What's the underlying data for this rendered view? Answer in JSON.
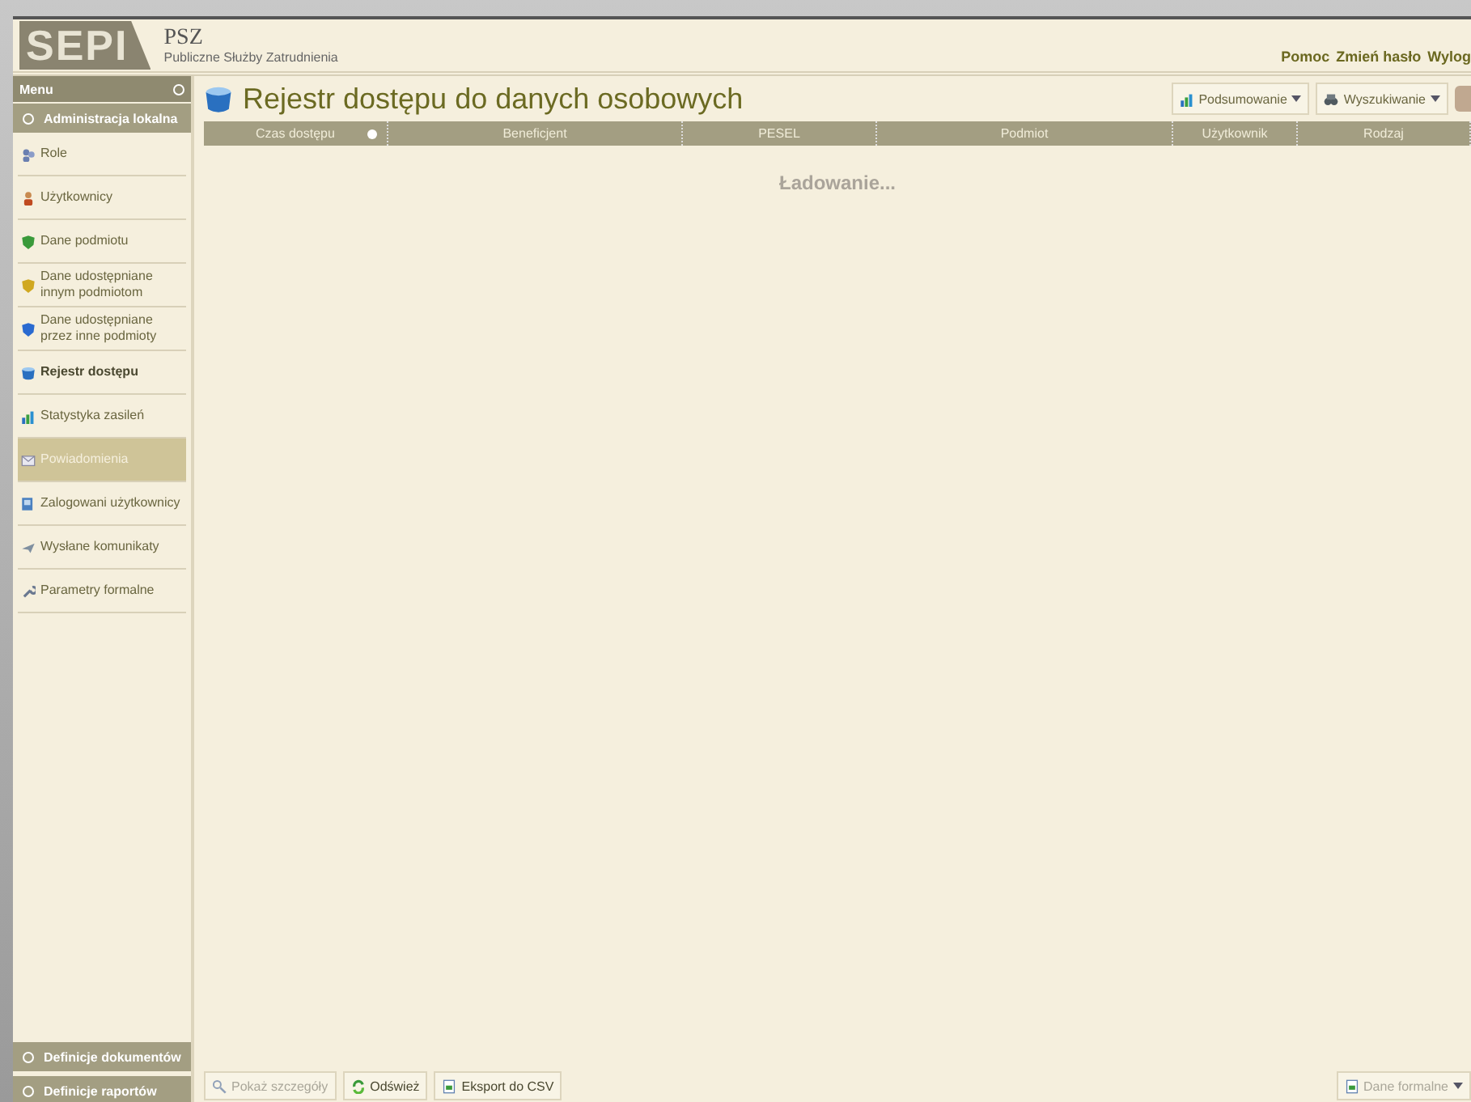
{
  "header": {
    "logo": "SEPI",
    "org_short": "PSZ",
    "org_name": "Publiczne Służby Zatrudnienia",
    "links": [
      "Pomoc",
      "Zmień hasło",
      "Wylog"
    ]
  },
  "sidebar": {
    "title": "Menu",
    "sections_top": [
      {
        "label": "Administracja lokalna"
      }
    ],
    "items": [
      {
        "label": "Role",
        "selected": false,
        "hovered": false
      },
      {
        "label": "Użytkownicy",
        "selected": false,
        "hovered": false
      },
      {
        "label": "Dane podmiotu",
        "selected": false,
        "hovered": false
      },
      {
        "label": "Dane udostępniane innym podmiotom",
        "selected": false,
        "hovered": false
      },
      {
        "label": "Dane udostępniane przez inne podmioty",
        "selected": false,
        "hovered": false
      },
      {
        "label": "Rejestr dostępu",
        "selected": true,
        "hovered": false
      },
      {
        "label": "Statystyka zasileń",
        "selected": false,
        "hovered": false
      },
      {
        "label": "Powiadomienia",
        "selected": false,
        "hovered": true
      },
      {
        "label": "Zalogowani użytkownicy",
        "selected": false,
        "hovered": false
      },
      {
        "label": "Wysłane komunikaty",
        "selected": false,
        "hovered": false
      },
      {
        "label": "Parametry formalne",
        "selected": false,
        "hovered": false
      }
    ],
    "sections_bottom": [
      {
        "label": "Definicje dokumentów"
      },
      {
        "label": "Definicje raportów"
      }
    ]
  },
  "page": {
    "title": "Rejestr dostępu do danych osobowych",
    "toolbar": [
      {
        "label": "Podsumowanie"
      },
      {
        "label": "Wyszukiwanie"
      }
    ],
    "table": {
      "columns": [
        {
          "label": "Czas dostępu",
          "sorted": true
        },
        {
          "label": "Beneficjent",
          "sorted": false
        },
        {
          "label": "PESEL",
          "sorted": false
        },
        {
          "label": "Podmiot",
          "sorted": false
        },
        {
          "label": "Użytkownik",
          "sorted": false
        },
        {
          "label": "Rodzaj",
          "sorted": false
        }
      ],
      "message": "Ładowanie..."
    },
    "footer_buttons": [
      {
        "label": "Pokaż szczegóły",
        "disabled": true
      },
      {
        "label": "Odśwież",
        "disabled": false
      },
      {
        "label": "Eksport do CSV",
        "disabled": false
      }
    ],
    "footer_menu": {
      "label": "Dane formalne",
      "disabled": true
    }
  }
}
